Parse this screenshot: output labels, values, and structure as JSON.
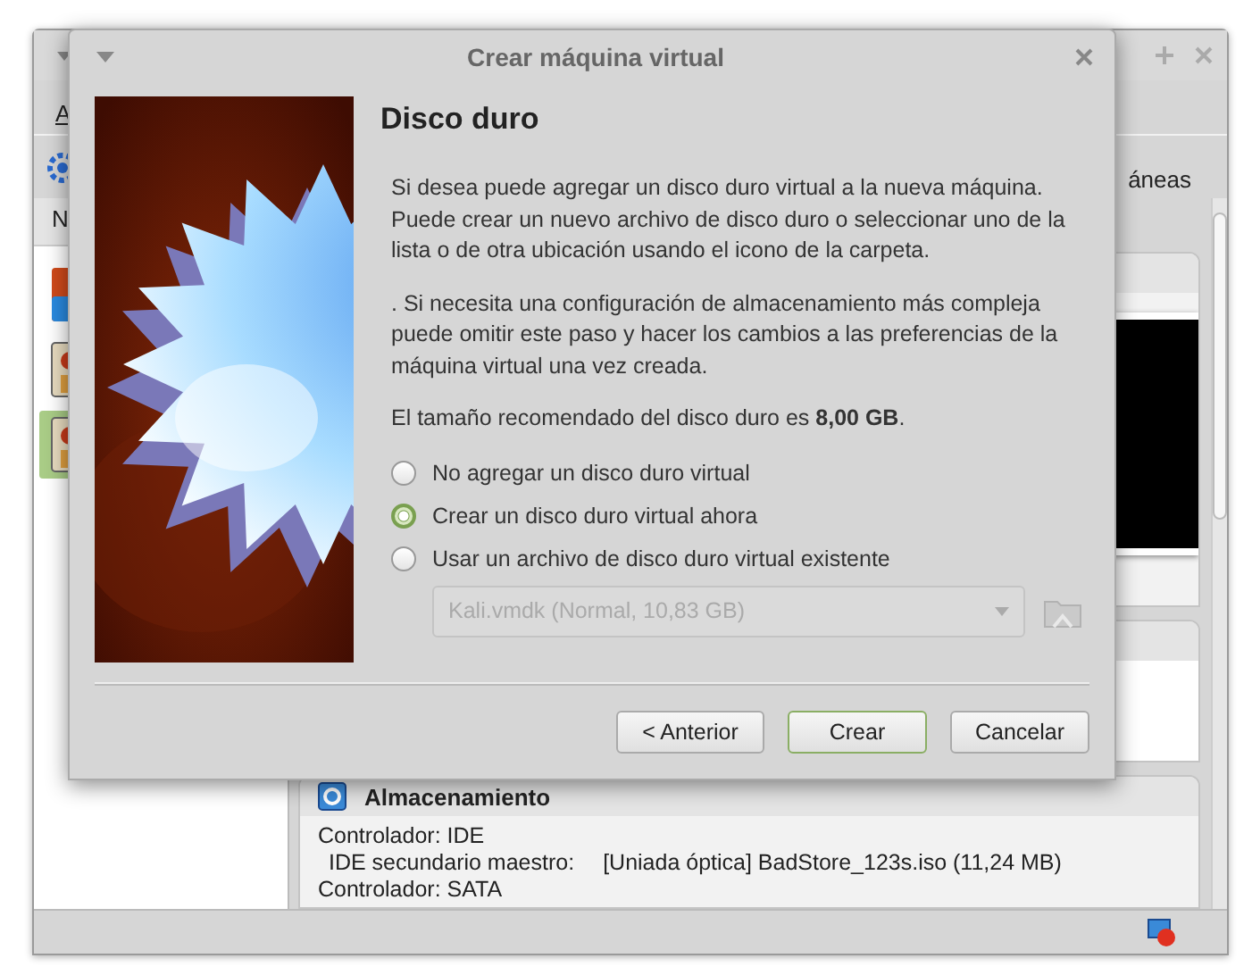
{
  "main_window": {
    "menu_item": "A",
    "toolbar_label": "áneas",
    "list_header": "N",
    "vm_list": [
      {
        "selected": false
      },
      {
        "selected": false
      },
      {
        "selected": true
      }
    ],
    "storage": {
      "title": "Almacenamiento",
      "lines": [
        {
          "label": "Controlador: IDE"
        },
        {
          "label": "IDE secundario maestro:",
          "value": "[Uniada óptica] BadStore_123s.iso (11,24 MB)"
        },
        {
          "label": "Controlador: SATA"
        }
      ]
    }
  },
  "dialog": {
    "title": "Crear máquina virtual",
    "heading": "Disco duro",
    "paragraphs": [
      "Si desea puede agregar un disco duro virtual a la nueva máquina. Puede crear un nuevo archivo de disco duro o seleccionar uno de la lista o de otra ubicación usando el icono de la carpeta.",
      ". Si necesita una configuración de almacenamiento más compleja puede omitir este paso y hacer los cambios a las preferencias de la máquina virtual una vez creada.",
      "El tamaño recomendado del disco duro es **8,00 GB**."
    ],
    "options": [
      {
        "label": "No agregar un disco duro virtual",
        "selected": false
      },
      {
        "label": "Crear un disco duro virtual ahora",
        "selected": true
      },
      {
        "label": "Usar un archivo de disco duro virtual existente",
        "selected": false
      }
    ],
    "disk_select": {
      "value": "Kali.vmdk (Normal, 10,83 GB)",
      "disabled": true
    },
    "buttons": [
      {
        "label": "< Anterior",
        "default": false
      },
      {
        "label": "Crear",
        "default": true
      },
      {
        "label": "Cancelar",
        "default": false
      }
    ]
  }
}
